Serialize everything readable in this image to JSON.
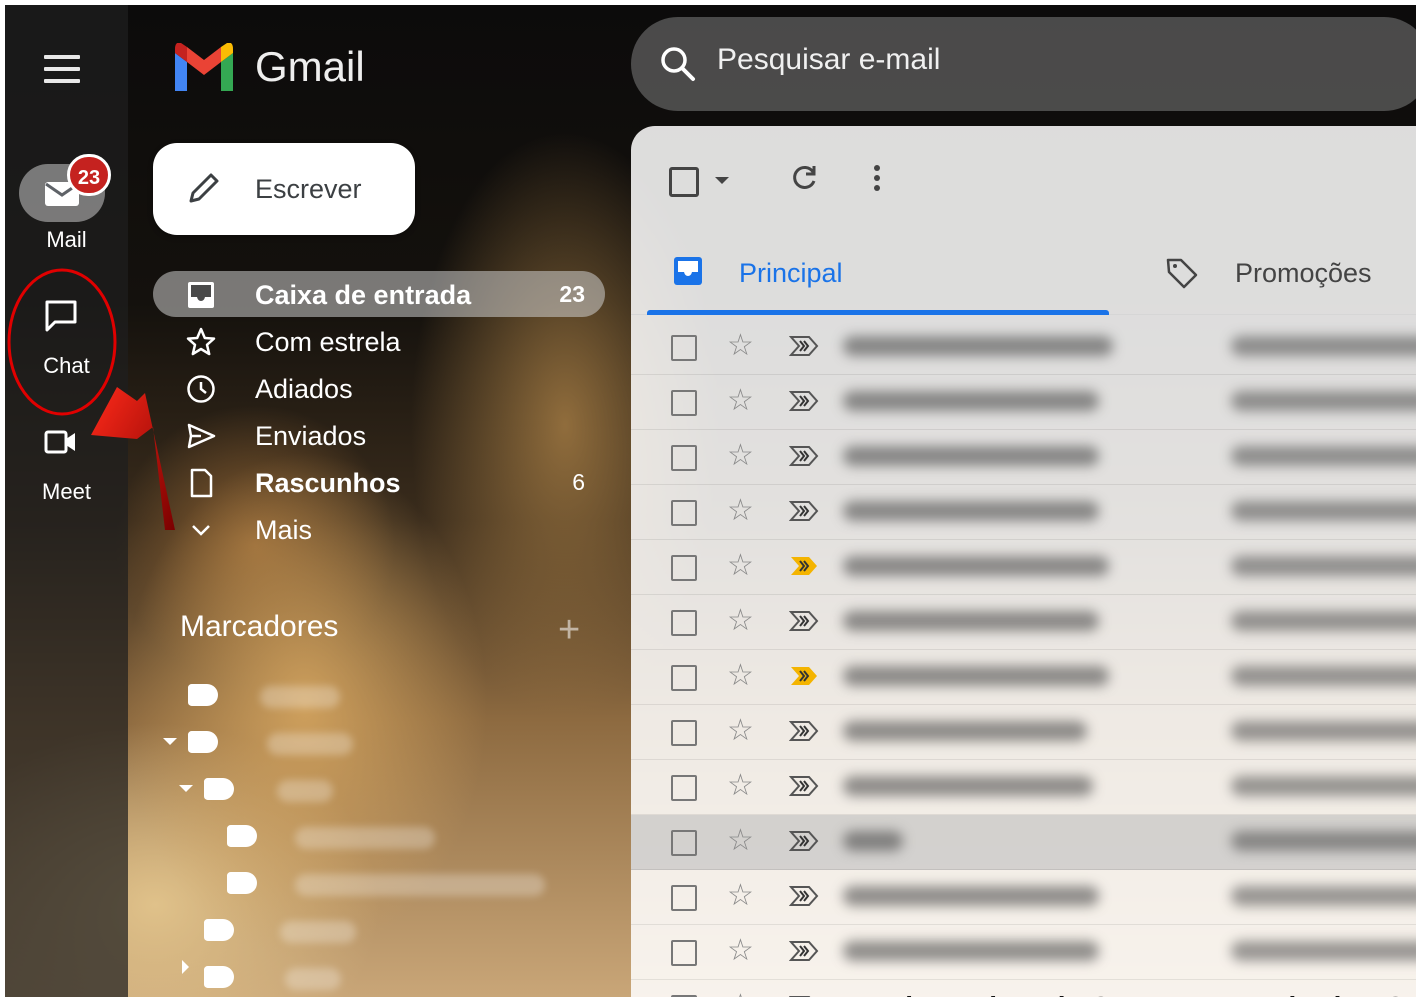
{
  "app": {
    "name": "Gmail",
    "mail_badge_count": "23"
  },
  "rail": {
    "items": [
      {
        "label": "Mail",
        "icon": "mail-icon"
      },
      {
        "label": "Chat",
        "icon": "chat-bubble-icon"
      },
      {
        "label": "Meet",
        "icon": "video-camera-icon"
      }
    ]
  },
  "compose": {
    "label": "Escrever",
    "icon": "pencil-icon"
  },
  "nav": {
    "items": [
      {
        "label": "Caixa de entrada",
        "count": "23",
        "icon": "inbox-icon",
        "active": true
      },
      {
        "label": "Com estrela",
        "count": "",
        "icon": "star-icon"
      },
      {
        "label": "Adiados",
        "count": "",
        "icon": "clock-icon"
      },
      {
        "label": "Enviados",
        "count": "",
        "icon": "send-icon"
      },
      {
        "label": "Rascunhos",
        "count": "6",
        "icon": "draft-icon"
      },
      {
        "label": "Mais",
        "count": "",
        "icon": "chevron-down-icon"
      }
    ]
  },
  "labels": {
    "title": "Marcadores",
    "add_icon": "plus-icon"
  },
  "search": {
    "placeholder": "Pesquisar e-mail",
    "value": ""
  },
  "toolbar": {
    "select_icon": "checkbox-icon",
    "refresh_icon": "refresh-icon",
    "more_icon": "more-vert-icon"
  },
  "tabs": [
    {
      "label": "Principal",
      "icon": "inbox-icon",
      "active": true
    },
    {
      "label": "Promoções",
      "icon": "tag-icon"
    }
  ],
  "last_row": {
    "sender": "#UntimaBabuttain C...",
    "subject": "Monitoria DC..."
  },
  "colors": {
    "accent": "#1a73e8",
    "badge": "#c5221f",
    "annotation": "#e00000",
    "important_marker": "#f4b400"
  }
}
